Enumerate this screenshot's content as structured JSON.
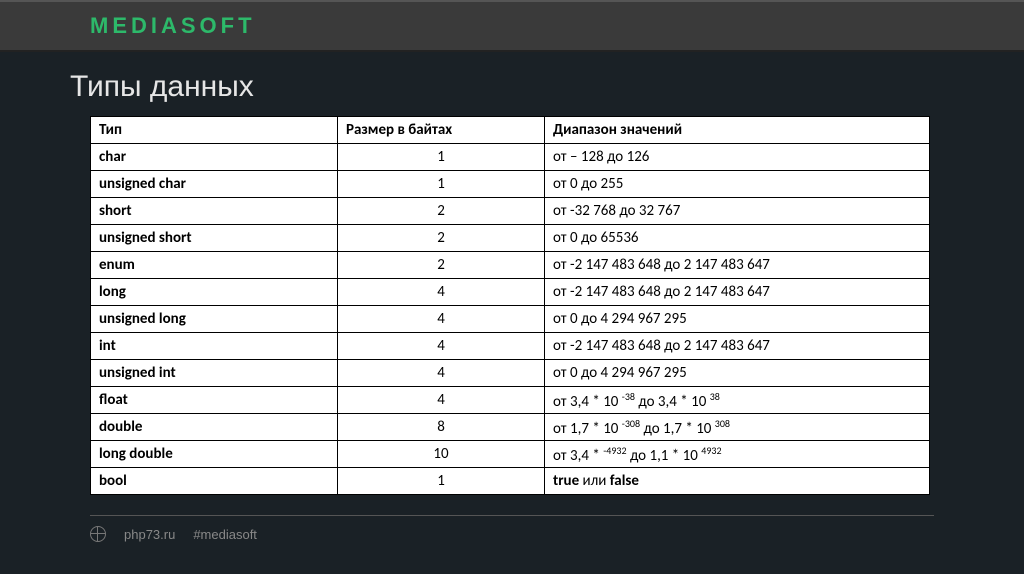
{
  "logo": "MEDIASOFT",
  "title": "Типы данных",
  "headers": {
    "type": "Тип",
    "size": "Размер в байтах",
    "range": "Диапазон значений"
  },
  "rows": [
    {
      "type": "char",
      "size": "1",
      "range": "от – 128 до 126"
    },
    {
      "type": "unsigned char",
      "size": "1",
      "range": "от 0 до 255"
    },
    {
      "type": "short",
      "size": "2",
      "range": "от -32 768 до 32 767"
    },
    {
      "type": "unsigned short",
      "size": "2",
      "range": "от 0 до 65536"
    },
    {
      "type": "enum",
      "size": "2",
      "range": "от -2 147 483 648 до 2 147 483 647"
    },
    {
      "type": "long",
      "size": "4",
      "range": "от -2 147 483 648 до 2 147 483 647"
    },
    {
      "type": "unsigned long",
      "size": "4",
      "range": "от 0 до 4 294 967 295"
    },
    {
      "type": "int",
      "size": "4",
      "range": "от -2 147 483 648 до 2 147 483 647"
    },
    {
      "type": "unsigned int",
      "size": "4",
      "range": "от 0 до 4 294 967 295"
    },
    {
      "type": "float",
      "size": "4",
      "range_html": "от 3,4 * 10 <span class='sup'>-38</span> до 3,4 * 10 <span class='sup'>38</span>"
    },
    {
      "type": "double",
      "size": "8",
      "range_html": "от 1,7 * 10 <span class='sup'>-308</span> до 1,7 * 10 <span class='sup'>308</span>"
    },
    {
      "type": "long double",
      "size": "10",
      "range_html": "от 3,4 * <span class='sup'>-4932</span> до 1,1 * 10 <span class='sup'>4932</span>"
    },
    {
      "type": "bool",
      "size": "1",
      "range_html": "<b>true</b> или <b>false</b>"
    }
  ],
  "footer": {
    "site": "php73.ru",
    "hashtag": "#mediasoft"
  }
}
